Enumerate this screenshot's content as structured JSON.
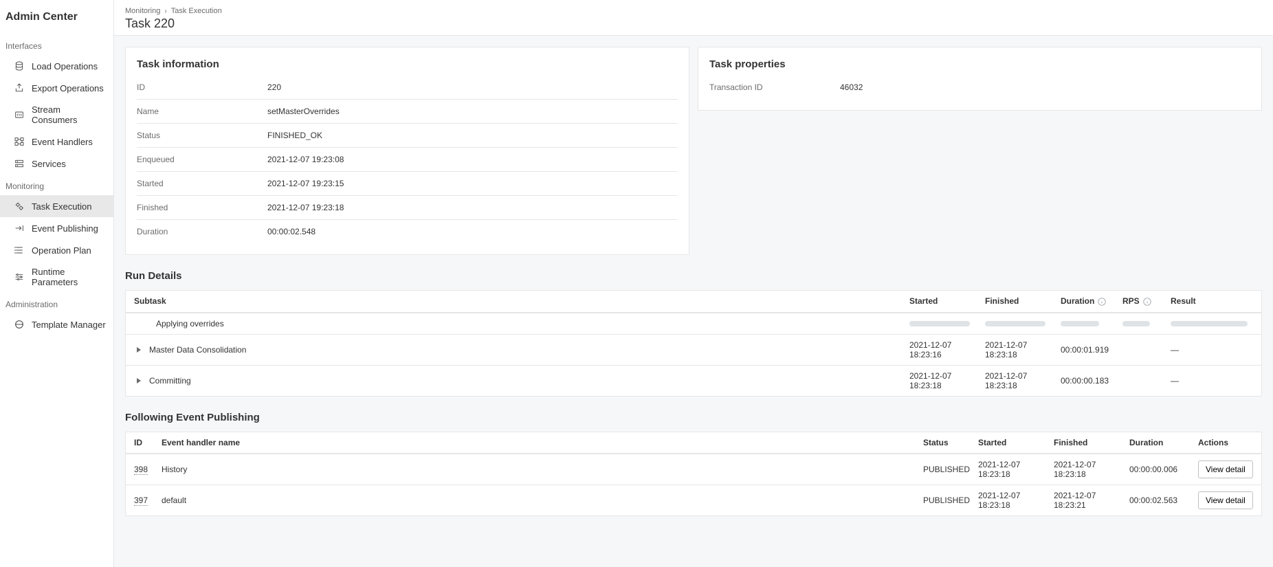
{
  "app": {
    "title": "Admin Center"
  },
  "sidebar": {
    "sections": [
      {
        "label": "Interfaces",
        "items": [
          {
            "label": "Load Operations",
            "icon": "load",
            "active": false
          },
          {
            "label": "Export Operations",
            "icon": "export",
            "active": false
          },
          {
            "label": "Stream Consumers",
            "icon": "stream",
            "active": false
          },
          {
            "label": "Event Handlers",
            "icon": "handlers",
            "active": false
          },
          {
            "label": "Services",
            "icon": "services",
            "active": false
          }
        ]
      },
      {
        "label": "Monitoring",
        "items": [
          {
            "label": "Task Execution",
            "icon": "gears",
            "active": true
          },
          {
            "label": "Event Publishing",
            "icon": "publish",
            "active": false
          },
          {
            "label": "Operation Plan",
            "icon": "plan",
            "active": false
          },
          {
            "label": "Runtime Parameters",
            "icon": "params",
            "active": false
          }
        ]
      },
      {
        "label": "Administration",
        "items": [
          {
            "label": "Template Manager",
            "icon": "template",
            "active": false
          }
        ]
      }
    ]
  },
  "breadcrumb": {
    "items": [
      {
        "label": "Monitoring"
      },
      {
        "label": "Task Execution"
      }
    ],
    "pageTitle": "Task 220"
  },
  "taskInfo": {
    "title": "Task information",
    "rows": [
      {
        "k": "ID",
        "v": "220"
      },
      {
        "k": "Name",
        "v": "setMasterOverrides"
      },
      {
        "k": "Status",
        "v": "FINISHED_OK"
      },
      {
        "k": "Enqueued",
        "v": "2021-12-07 19:23:08"
      },
      {
        "k": "Started",
        "v": "2021-12-07 19:23:15"
      },
      {
        "k": "Finished",
        "v": "2021-12-07 19:23:18"
      },
      {
        "k": "Duration",
        "v": "00:00:02.548"
      }
    ]
  },
  "taskProps": {
    "title": "Task properties",
    "rows": [
      {
        "k": "Transaction ID",
        "v": "46032"
      }
    ]
  },
  "runDetails": {
    "title": "Run Details",
    "headers": {
      "subtask": "Subtask",
      "started": "Started",
      "finished": "Finished",
      "duration": "Duration",
      "rps": "RPS",
      "result": "Result"
    },
    "rows": [
      {
        "type": "loading",
        "subtask": "Applying overrides"
      },
      {
        "type": "expandable",
        "subtask": "Master Data Consolidation",
        "started": "2021-12-07 18:23:16",
        "finished": "2021-12-07 18:23:18",
        "duration": "00:00:01.919",
        "rps": "",
        "result": "—"
      },
      {
        "type": "expandable",
        "subtask": "Committing",
        "started": "2021-12-07 18:23:18",
        "finished": "2021-12-07 18:23:18",
        "duration": "00:00:00.183",
        "rps": "",
        "result": "—"
      }
    ]
  },
  "eventPub": {
    "title": "Following Event Publishing",
    "headers": {
      "id": "ID",
      "name": "Event handler name",
      "status": "Status",
      "started": "Started",
      "finished": "Finished",
      "duration": "Duration",
      "actions": "Actions"
    },
    "actionLabel": "View detail",
    "rows": [
      {
        "id": "398",
        "name": "History",
        "status": "PUBLISHED",
        "started": "2021-12-07 18:23:18",
        "finished": "2021-12-07 18:23:18",
        "duration": "00:00:00.006"
      },
      {
        "id": "397",
        "name": "default",
        "status": "PUBLISHED",
        "started": "2021-12-07 18:23:18",
        "finished": "2021-12-07 18:23:21",
        "duration": "00:00:02.563"
      }
    ]
  }
}
